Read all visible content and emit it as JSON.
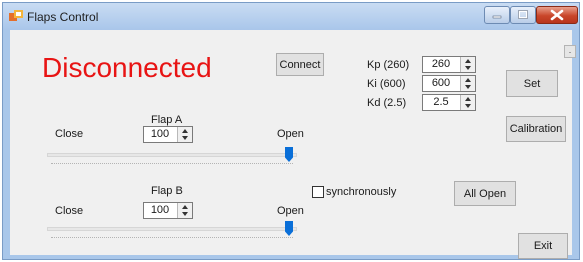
{
  "window": {
    "title": "Flaps Control",
    "minimize_label": "",
    "maximize_label": "",
    "close_label": ""
  },
  "status": {
    "text": "Disconnected",
    "color": "#e81414"
  },
  "buttons": {
    "connect": "Connect",
    "set": "Set",
    "calibration": "Calibration",
    "all_open": "All Open",
    "exit": "Exit",
    "corner": "."
  },
  "pid": {
    "kp": {
      "label": "Kp (260)",
      "value": "260"
    },
    "ki": {
      "label": "Ki (600)",
      "value": "600"
    },
    "kd": {
      "label": "Kd (2.5)",
      "value": "2.5"
    }
  },
  "flap_a": {
    "title": "Flap A",
    "close_label": "Close",
    "open_label": "Open",
    "value": "100",
    "slider_level": 1.0
  },
  "flap_b": {
    "title": "Flap B",
    "close_label": "Close",
    "open_label": "Open",
    "value": "100",
    "slider_level": 1.0
  },
  "sync": {
    "label": "synchronously",
    "checked": false
  },
  "icons": {
    "app": "app-icon",
    "spin_up": "arrow-up-icon",
    "spin_down": "arrow-down-icon"
  },
  "colors": {
    "accent": "#0a6fd8",
    "titlebar": "#b9d1ee",
    "close_button": "#c9462a"
  }
}
